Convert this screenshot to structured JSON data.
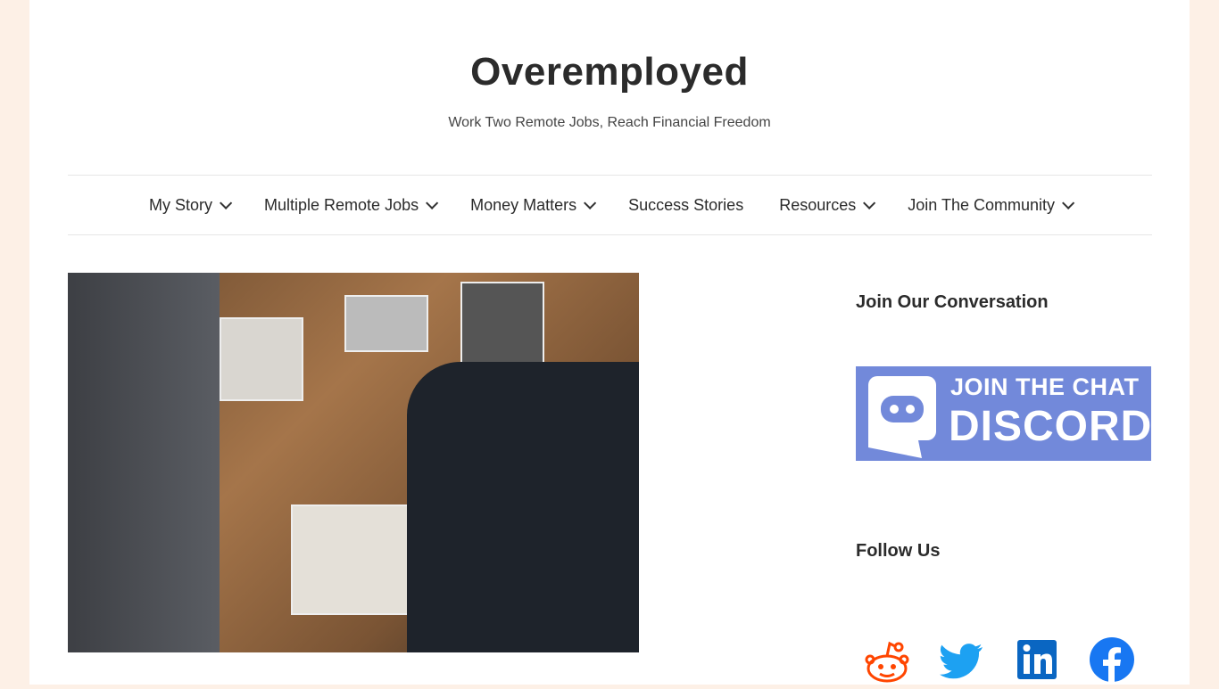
{
  "site": {
    "title": "Overemployed",
    "tagline": "Work Two Remote Jobs, Reach Financial Freedom"
  },
  "nav": [
    {
      "label": "My Story",
      "dropdown": true
    },
    {
      "label": "Multiple Remote Jobs",
      "dropdown": true
    },
    {
      "label": "Money Matters",
      "dropdown": true
    },
    {
      "label": "Success Stories",
      "dropdown": false
    },
    {
      "label": "Resources",
      "dropdown": true
    },
    {
      "label": "Join The Community",
      "dropdown": true
    }
  ],
  "sidebar": {
    "conversation_title": "Join Our Conversation",
    "discord": {
      "line1": "JOIN THE CHAT",
      "line2": "DISCORD",
      "color": "#7289da"
    },
    "follow_title": "Follow Us",
    "social": [
      "reddit-icon",
      "twitter-icon",
      "linkedin-icon",
      "facebook-icon"
    ]
  },
  "colors": {
    "background": "#fdf0e6",
    "reddit": "#ff4500",
    "twitter": "#1da1f2",
    "linkedin": "#0a66c2",
    "facebook": "#1877f2"
  }
}
